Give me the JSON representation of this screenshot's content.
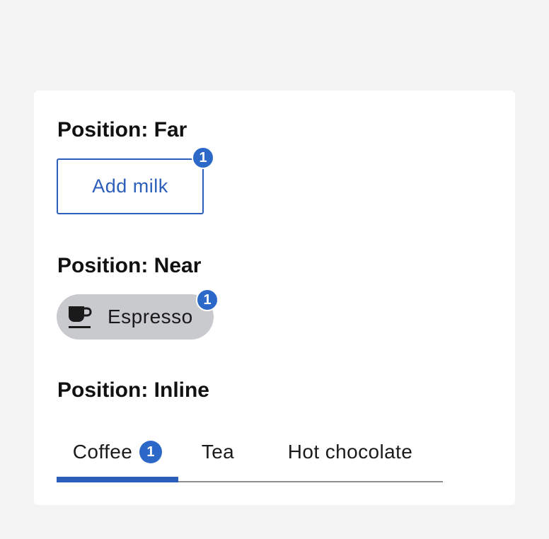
{
  "sections": {
    "far": {
      "heading": "Position: Far",
      "button_label": "Add milk",
      "badge": "1"
    },
    "near": {
      "heading": "Position: Near",
      "chip_label": "Espresso",
      "chip_icon": "coffee-cup-icon",
      "badge": "1"
    },
    "inline": {
      "heading": "Position: Inline",
      "tabs": [
        {
          "label": "Coffee",
          "badge": "1",
          "selected": true
        },
        {
          "label": "Tea",
          "selected": false
        },
        {
          "label": "Hot chocolate",
          "selected": false
        }
      ]
    }
  },
  "colors": {
    "accent": "#2b5fb9",
    "badge": "#2b68c7",
    "chip_bg": "#c9cacd",
    "page_bg": "#f3f3f3"
  }
}
